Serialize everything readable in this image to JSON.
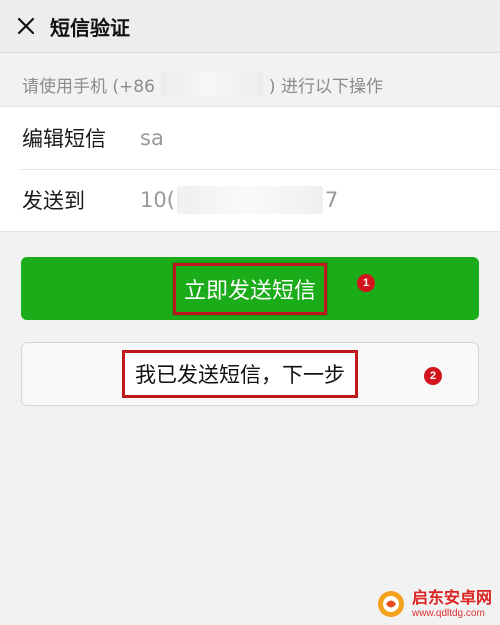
{
  "header": {
    "close_icon": "close-icon",
    "title": "短信验证"
  },
  "hint": {
    "prefix": "请使用手机 (+86",
    "suffix": ") 进行以下操作"
  },
  "form": {
    "sms_label": "编辑短信",
    "sms_value": "sa",
    "to_label": "发送到",
    "to_value_start": "10(",
    "to_value_end": "7"
  },
  "buttons": {
    "send_now": "立即发送短信",
    "already_sent": "我已发送短信，下一步"
  },
  "annotations": {
    "step1": "1",
    "step2": "2"
  },
  "watermark": {
    "name": "启东安卓网",
    "url": "www.qdltdg.com"
  },
  "colors": {
    "primary_green": "#1aad19",
    "highlight_red": "#c0181f",
    "badge_red": "#d3141c"
  }
}
